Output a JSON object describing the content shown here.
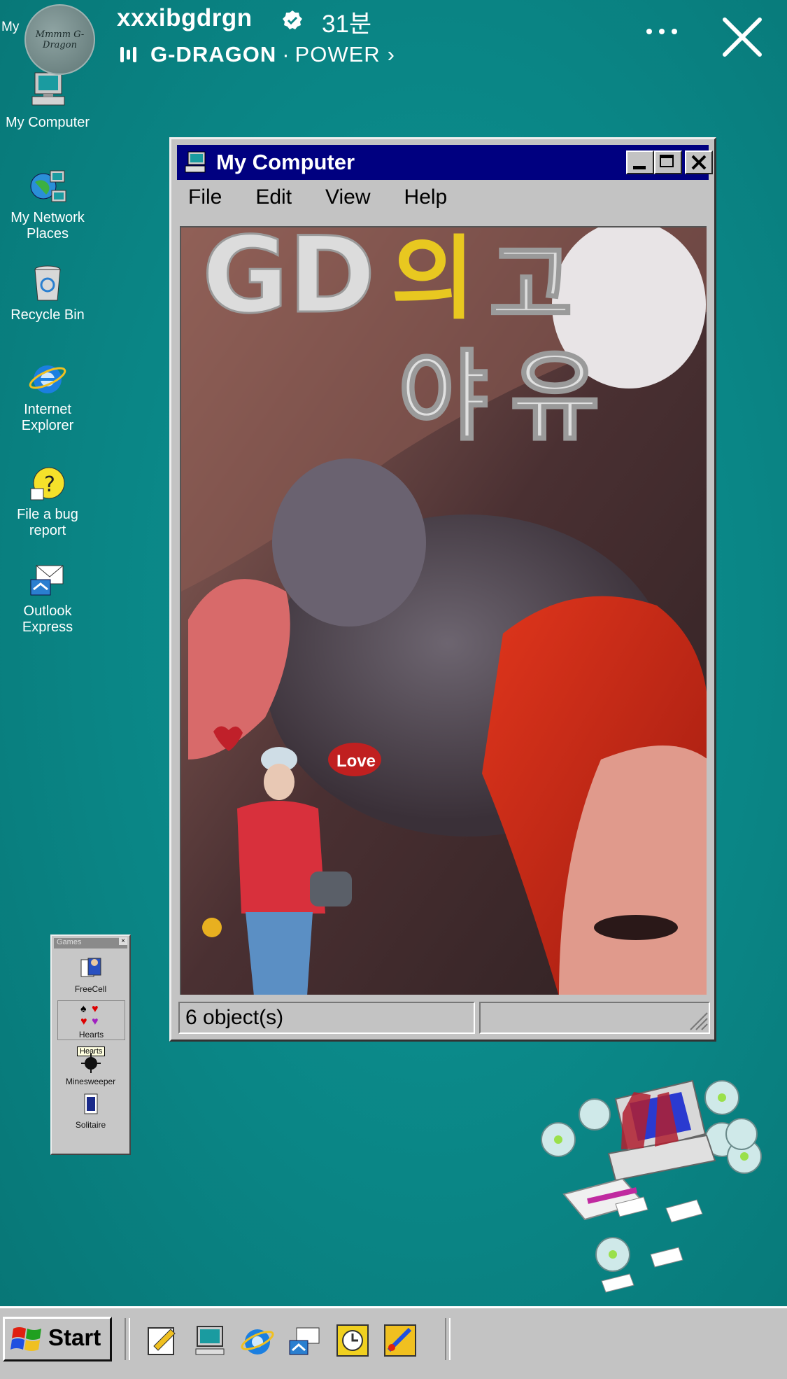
{
  "story": {
    "username": "xxxibgdrgn",
    "time_ago": "31분",
    "music_artist": "G-DRAGON",
    "music_separator": "·",
    "music_song": "POWER",
    "avatar_signature": "Mmmm G-Dragon"
  },
  "desktop_icons": [
    {
      "label": "My Computer"
    },
    {
      "line1": "My Network",
      "line2": "Places"
    },
    {
      "label": "Recycle Bin"
    },
    {
      "line1": "Internet",
      "line2": "Explorer"
    },
    {
      "line1": "File a bug",
      "line2": "report"
    },
    {
      "line1": "Outlook",
      "line2": "Express"
    }
  ],
  "desktop_partial_label": "My",
  "window": {
    "title": "My Computer",
    "menu": [
      "File",
      "Edit",
      "View",
      "Help"
    ],
    "status": "6 object(s)"
  },
  "content_art": {
    "line1_latin": "GD",
    "line1_korean": "의",
    "line2": "고",
    "line3": "야",
    "line3b": "유",
    "sticker": "Love"
  },
  "games": {
    "title": "Games",
    "items": [
      "FreeCell",
      "Hearts",
      "Minesweeper",
      "Solitaire"
    ],
    "tooltip": "Hearts"
  },
  "taskbar": {
    "start_label": "Start"
  },
  "colors": {
    "desktop": "#0a8686",
    "titlebar": "#000080",
    "chrome": "#c3c3c3"
  }
}
